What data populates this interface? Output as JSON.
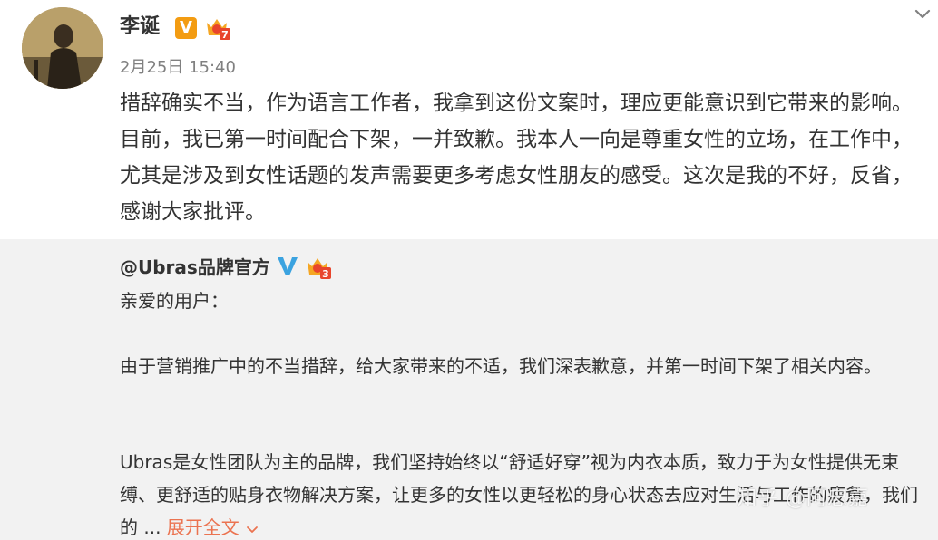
{
  "post": {
    "author": "李诞",
    "time": "2月25日 15:40",
    "text": "措辞确实不当，作为语言工作者，我拿到这份文案时，理应更能意识到它带来的影响。目前，我已第一时间配合下架，一并致歉。我本人一向是尊重女性的立场，在工作中，尤其是涉及到女性话题的发声需要更多考虑女性朋友的感受。这次是我的不好，反省，感谢大家批评。",
    "vip_badge": "V",
    "level_badge": "7"
  },
  "repost": {
    "author": "@Ubras品牌官方",
    "level_badge": "3",
    "greeting": "亲爱的用户：",
    "paragraph1": "由于营销推广中的不当措辞，给大家带来的不适，我们深表歉意，并第一时间下架了相关内容。",
    "paragraph2": "Ubras是女性团队为主的品牌，我们坚持始终以“舒适好穿”视为内衣本质，致力于为女性提供无束缚、更舒适的贴身衣物解决方案，让更多的女性以更轻松的身心状态去应对生活与工作的疲惫，我们的 ...",
    "expand_label": "展开全文"
  },
  "watermark": "知乎 @阿忠嘉",
  "colors": {
    "link": "#eb7350",
    "repost_bg": "#f2f2f2",
    "vip_orange": "#f39c12",
    "verify_blue": "#3ba3e0"
  }
}
